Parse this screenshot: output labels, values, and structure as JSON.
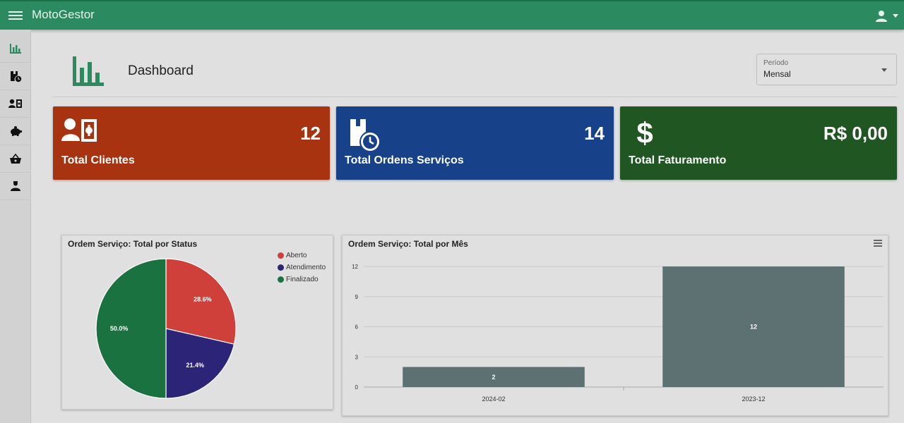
{
  "app": {
    "title": "MotoGestor"
  },
  "topbar": {
    "menu_icon": "menu-icon",
    "user_icon": "account-icon"
  },
  "sidebar": {
    "items": [
      {
        "icon": "bar-chart-icon",
        "active": true
      },
      {
        "icon": "service-order-icon",
        "active": false
      },
      {
        "icon": "client-card-icon",
        "active": false
      },
      {
        "icon": "piggy-bank-icon",
        "active": false
      },
      {
        "icon": "shopping-basket-icon",
        "active": false
      },
      {
        "icon": "user-icon",
        "active": false
      }
    ]
  },
  "header": {
    "title": "Dashboard",
    "period_label": "Período",
    "period_value": "Mensal"
  },
  "cards": [
    {
      "label": "Total Clientes",
      "value": "12",
      "color": "#a83311",
      "icon": "client-card-icon"
    },
    {
      "label": "Total Ordens Serviços",
      "value": "14",
      "color": "#174189",
      "icon": "service-order-clock-icon"
    },
    {
      "label": "Total Faturamento",
      "value": "R$ 0,00",
      "color": "#1f5621",
      "icon": "dollar-icon"
    }
  ],
  "colors": {
    "accent": "#2b8a5f",
    "aberto": "#d0403a",
    "atendimento": "#2c2577",
    "finalizado": "#19723f",
    "bar": "#5d7072"
  },
  "chart_data": [
    {
      "type": "pie",
      "title": "Ordem Serviço: Total por Status",
      "categories": [
        "Aberto",
        "Atendimento",
        "Finalizado"
      ],
      "values": [
        28.6,
        21.4,
        50.0
      ],
      "labels": [
        "28.6%",
        "21.4%",
        "50.0%"
      ],
      "legend": "top-right"
    },
    {
      "type": "bar",
      "title": "Ordem Serviço: Total por Mês",
      "categories": [
        "2024-02",
        "2023-12"
      ],
      "values": [
        2,
        12
      ],
      "yticks": [
        "0",
        "3",
        "6",
        "9",
        "12"
      ],
      "ylim": [
        0,
        12
      ],
      "grid": true
    }
  ]
}
